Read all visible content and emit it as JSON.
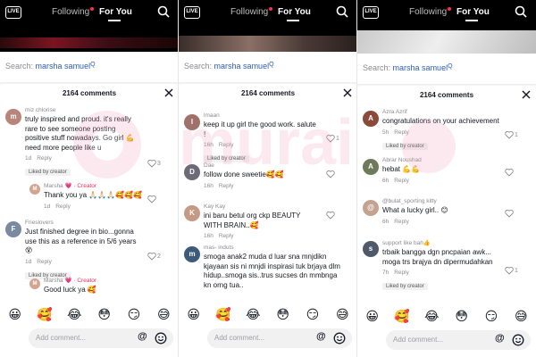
{
  "top": {
    "live_label": "LIVE",
    "tab_following": "Following",
    "tab_foryou": "For You"
  },
  "search": {
    "label": "Search:",
    "term": "marsha samuel",
    "q_mark": "Q"
  },
  "sheet": {
    "count": "2164 comments",
    "add_placeholder": "Add comment...",
    "at_symbol": "@"
  },
  "emojis": [
    "😀",
    "🥰",
    "😂",
    "😳",
    "😏",
    "😅"
  ],
  "colors": {
    "accent_red": "#fe2c55",
    "link_blue": "#2b5db9",
    "muted_gray": "#8a8b91"
  },
  "watermark_text": "murai",
  "panels": [
    {
      "comments": [
        {
          "user": "miz chlorise",
          "text": "truly inspired and proud. it's really rare to see someone posting positive stuff nowadays. Go girl 💪 need more people like u",
          "time": "1d",
          "reply": "Reply",
          "likes": "3",
          "badge": "Liked by creator",
          "avatar": "m"
        },
        {
          "user": "Marsha 💗",
          "creator": "· Creator",
          "text": "Thank you ya 🙏🏻🙏🏻🙏🏻🥰🥰🥰",
          "time": "1d",
          "reply": "Reply",
          "likes": "",
          "badge": "",
          "avatar": "M",
          "is_reply": true
        },
        {
          "user": "Frieslovers",
          "creator": "",
          "text": "Just finished degree in bio...gonna use this as a reference in 5/6 years😵",
          "time": "1d",
          "reply": "Reply",
          "likes": "2",
          "badge": "Liked by creator",
          "avatar": "F"
        },
        {
          "user": "Marsha 💗",
          "creator": "· Creator",
          "text": "Good luck ya 🥰",
          "time": "",
          "reply": "",
          "likes": "",
          "badge": "",
          "avatar": "M",
          "is_reply": true
        }
      ]
    },
    {
      "comments": [
        {
          "user": "lmaan",
          "text": "keep it up girl the good work. salute !",
          "time": "16h",
          "reply": "Reply",
          "likes": "1",
          "badge": "Liked by creator",
          "avatar": "l"
        },
        {
          "user": "Dae",
          "text": "follow done sweetie🥰🥰",
          "time": "16h",
          "reply": "Reply",
          "likes": "",
          "badge": "",
          "avatar": "D"
        },
        {
          "user": "Kay Kay",
          "text": "ini baru betul org ckp BEAUTY WITH BRAIN..🥰",
          "time": "16h",
          "reply": "Reply",
          "likes": "",
          "badge": "",
          "avatar": "K"
        },
        {
          "user": "mas- induts",
          "text": "smoga anak2 muda d luar sna mnjdikn kjayaan sis ni mnjdi inspirasi tuk brjaya dlm hidup..smoga sis..trus sucses dn mmbnga kn orng tua..",
          "time": "",
          "reply": "",
          "likes": "",
          "badge": "",
          "avatar": "m"
        }
      ]
    },
    {
      "comments": [
        {
          "user": "Azra Azrif",
          "text": "congratulations on your achievement",
          "time": "5h",
          "reply": "Reply",
          "likes": "1",
          "badge": "Liked by creator",
          "avatar": "A"
        },
        {
          "user": "Abrar Noushad",
          "text": "hebat 💪💪",
          "time": "6h",
          "reply": "Reply",
          "likes": "",
          "badge": "",
          "avatar": "A"
        },
        {
          "user": "@bulat_sporting kitty",
          "text": "What a lucky girl.. 😊",
          "time": "6h",
          "reply": "Reply",
          "likes": "",
          "badge": "",
          "avatar": "@"
        },
        {
          "user": "support like bah👍",
          "text": "trbaik bangga dgn pncpaian awk... moga trs brajya dn dipermudahkan",
          "time": "7h",
          "reply": "Reply",
          "likes": "1",
          "badge": "Liked by creator",
          "avatar": "s"
        }
      ]
    }
  ]
}
